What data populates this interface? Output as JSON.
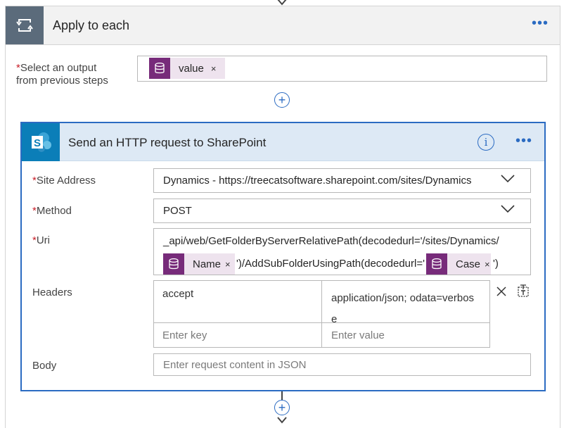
{
  "apply_to_each": {
    "title": "Apply to each",
    "output_label_line1": "Select an output",
    "output_label_line2": "from previous steps",
    "required_mark": "*",
    "token": {
      "label": "value",
      "remove": "×"
    }
  },
  "action": {
    "title": "Send an HTTP request to SharePoint",
    "info": "i",
    "site_address": {
      "label": "Site Address",
      "value": "Dynamics - https://treecatsoftware.sharepoint.com/sites/Dynamics"
    },
    "method": {
      "label": "Method",
      "value": "POST"
    },
    "uri": {
      "label": "Uri",
      "line1": "_api/web/GetFolderByServerRelativePath(decodedurl='/sites/Dynamics/",
      "token1": "Name",
      "middle": "')/AddSubFolderUsingPath(decodedurl='",
      "token2": "Case",
      "end": "')",
      "remove": "×"
    },
    "headers": {
      "label": "Headers",
      "key": "accept",
      "value_line1": "application/json; odata=verbos",
      "value_line2": "e",
      "key_placeholder": "Enter key",
      "value_placeholder": "Enter value"
    },
    "body": {
      "label": "Body",
      "placeholder": "Enter request content in JSON"
    }
  },
  "colors": {
    "accent": "#2b6bc2",
    "token": "#772b7a",
    "sharepoint": "#0b7eb8",
    "loop": "#5b6b7b"
  }
}
